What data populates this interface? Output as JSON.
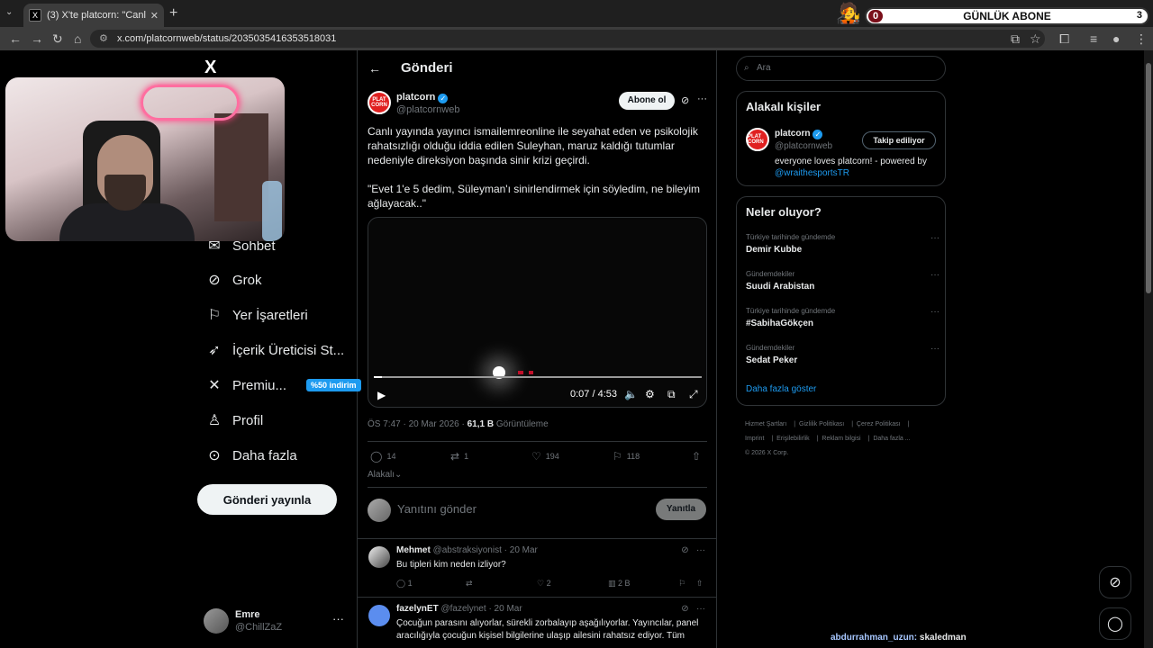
{
  "browser": {
    "tab_title": "(3) X'te platcorn: \"Canlı yayında",
    "url": "x.com/platcornweb/status/2035035416353518031"
  },
  "overlay": {
    "label": "GÜNLÜK ABONE",
    "count_left": "0",
    "count_right": "3"
  },
  "nav": {
    "logo": "X",
    "items": [
      {
        "label": "Sohbet",
        "icon": "chat-icon"
      },
      {
        "label": "Grok",
        "icon": "grok-icon"
      },
      {
        "label": "Yer İşaretleri",
        "icon": "bookmark-icon"
      },
      {
        "label": "İçerik Üreticisi St...",
        "icon": "rocket-icon"
      },
      {
        "label": "Premiu...",
        "icon": "x-icon",
        "badge": "%50 indirim"
      },
      {
        "label": "Profil",
        "icon": "person-icon"
      },
      {
        "label": "Daha fazla",
        "icon": "more-circle-icon"
      }
    ],
    "post_button": "Gönderi yayınla",
    "user": {
      "name": "Emre",
      "handle": "@ChillZaZ"
    }
  },
  "main": {
    "header_title": "Gönderi",
    "post": {
      "author_name": "platcorn",
      "author_handle": "@platcornweb",
      "avatar_text": "PLAT CORN",
      "subscribe_label": "Abone ol",
      "text": "Canlı yayında yayıncı ismailemreonline ile seyahat eden ve psikolojik rahatsızlığı olduğu iddia edilen Suleyhan, maruz kaldığı tutumlar nedeniyle direksiyon başında sinir krizi geçirdi.",
      "quote": "\"Evet 1'e 5 dedim, Süleyman'ı sinirlendirmek için söyledim, ne bileyim ağlayacak..\"",
      "video_time": "0:07 / 4:53",
      "video_progress": 0.024,
      "timestamp": "ÖS 7:47 · 20 Mar 2026 · ",
      "views_count": "61,1 B",
      "views_label": " Görüntüleme",
      "replies": "14",
      "reposts": "1",
      "likes": "194",
      "bookmarks": "118",
      "relevance": "Alakalı"
    },
    "reply_box": {
      "placeholder": "Yanıtını gönder",
      "button": "Yanıtla"
    },
    "replies": [
      {
        "name": "Mehmet",
        "handle": "@abstraksiyonist",
        "date": "· 20 Mar",
        "text": "Bu tipleri kim neden izliyor?",
        "reply_count": "1",
        "like_count": "2",
        "view_count": "2 B"
      },
      {
        "name": "fazelynET",
        "handle": "@fazelynet",
        "date": "· 20 Mar",
        "text": "Çocuğun parasını alıyorlar, sürekli zorbalayıp aşağılıyorlar. Yayıncılar, panel aracılığıyla çocuğun kişisel bilgilerine ulaşıp ailesini rahatsız ediyor. Tüm"
      }
    ]
  },
  "sidebar": {
    "search_placeholder": "Ara",
    "related_title": "Alakalı kişiler",
    "related": {
      "name": "platcorn",
      "handle": "@platcornweb",
      "follow_label": "Takip ediliyor",
      "bio": "everyone loves platcorn! - powered by ",
      "bio_link": "@wraithesportsTR"
    },
    "trends_title": "Neler oluyor?",
    "trends": [
      {
        "context": "Türkiye tarihinde gündemde",
        "name": "Demir Kubbe"
      },
      {
        "context": "Gündemdekiler",
        "name": "Suudi Arabistan"
      },
      {
        "context": "Türkiye tarihinde gündemde",
        "name": "#SabihaGökçen"
      },
      {
        "context": "Gündemdekiler",
        "name": "Sedat Peker"
      }
    ],
    "show_more": "Daha fazla göster",
    "footer": [
      "Hizmet Şartları",
      "Gizlilik Politikası",
      "Çerez Politikası",
      "Imprint",
      "Erişilebilirlik",
      "Reklam bilgisi",
      "Daha fazla ...",
      "© 2026 X Corp."
    ]
  },
  "chat_overlay": {
    "user": "abdurrahman_uzun:",
    "message": " skaledman"
  }
}
